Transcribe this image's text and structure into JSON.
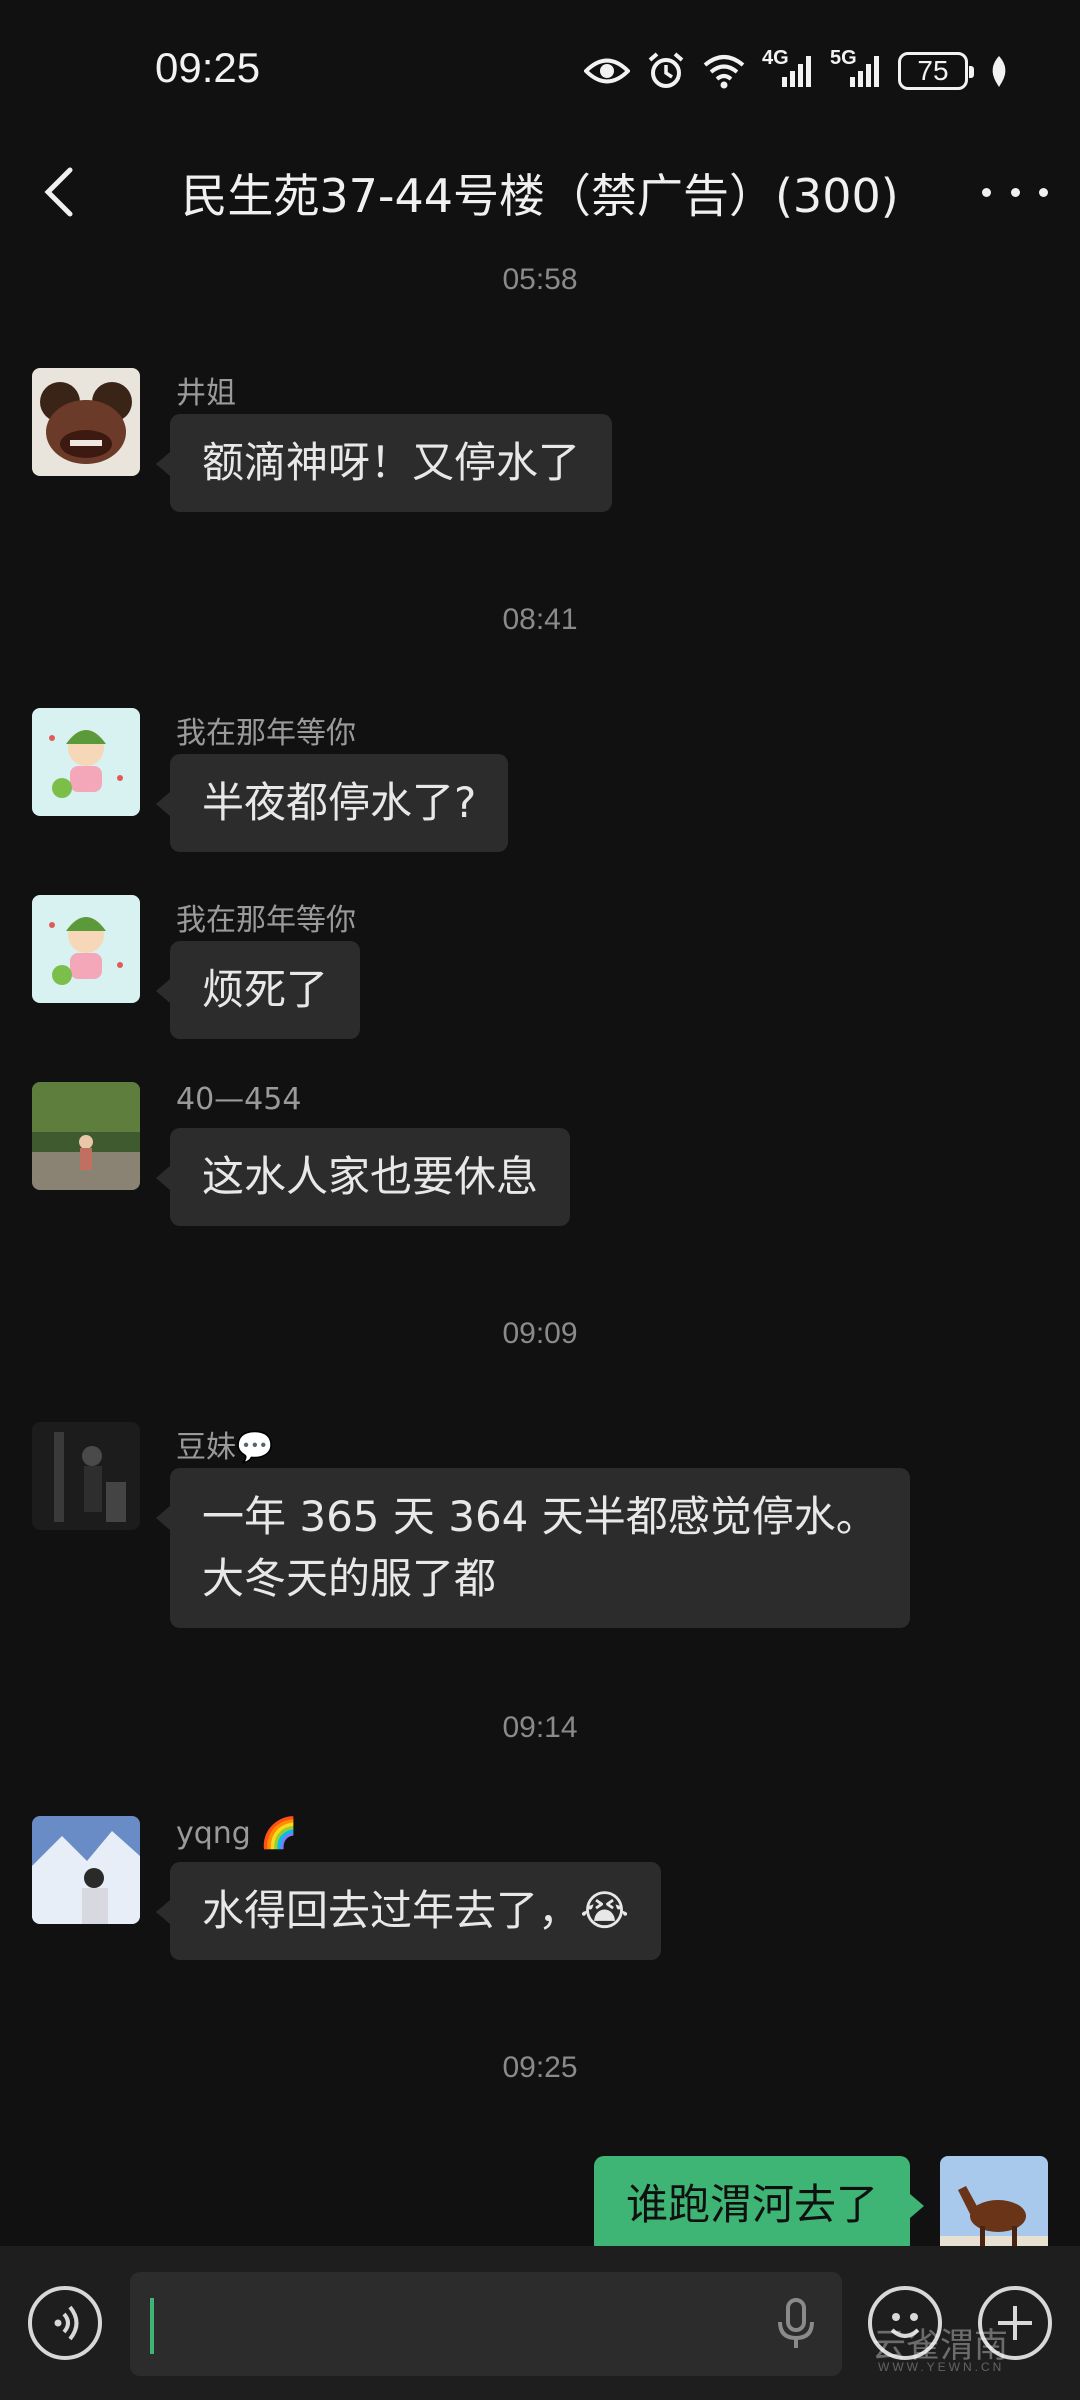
{
  "status_bar": {
    "time": "09:25",
    "net_4g": "4G",
    "net_5g": "5G",
    "battery": "75",
    "icons": [
      "eye-comfort-icon",
      "alarm-icon",
      "wifi-icon",
      "signal-4g-icon",
      "signal-5g-icon",
      "battery-icon",
      "leaf-icon"
    ]
  },
  "header": {
    "title": "民生苑37-44号楼（禁广告）(300)",
    "back_icon": "chevron-left-icon",
    "more_icon": "more-dots-icon"
  },
  "messages": {
    "ts1": "05:58",
    "m1": {
      "sender": "井姐",
      "text": "额滴神呀！又停水了"
    },
    "ts2": "08:41",
    "m2": {
      "sender": "我在那年等你",
      "text": "半夜都停水了?"
    },
    "m3": {
      "sender": "我在那年等你",
      "text": "烦死了"
    },
    "m4": {
      "sender": "40—454",
      "text": "这水人家也要休息"
    },
    "ts3": "09:09",
    "m5": {
      "sender": "豆妹💬",
      "line1": "一年 365 天 364 天半都感觉停水。",
      "line2": "大冬天的服了都"
    },
    "ts4": "09:14",
    "m6": {
      "sender": "yqng 🌈",
      "text": "水得回去过年去了，😭"
    },
    "ts5": "09:25",
    "m7": {
      "text": "谁跑渭河去了"
    }
  },
  "input_bar": {
    "value": "",
    "icons": [
      "voice-mode-icon",
      "microphone-icon",
      "emoji-icon",
      "plus-icon"
    ]
  },
  "watermark": {
    "text": "云雀渭南",
    "sub": "WWW.YEWN.CN"
  },
  "colors": {
    "background": "#111111",
    "bubble_other": "#2c2c2c",
    "bubble_self": "#3eb575"
  }
}
